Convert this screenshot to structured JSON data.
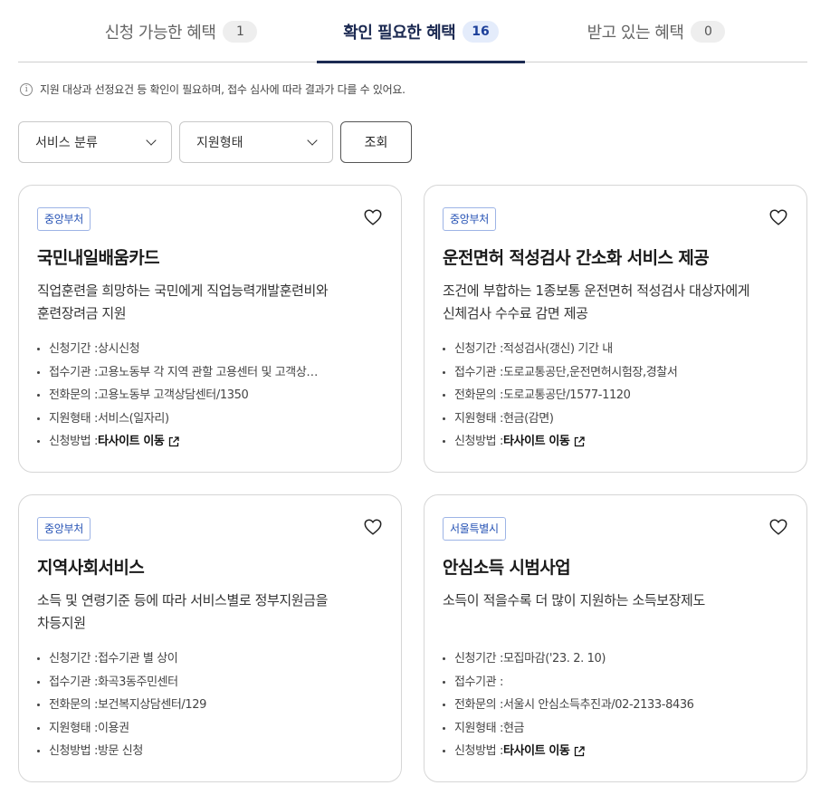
{
  "tabs": [
    {
      "label": "신청 가능한 혜택",
      "count": "1"
    },
    {
      "label": "확인 필요한 혜택",
      "count": "16"
    },
    {
      "label": "받고 있는 혜택",
      "count": "0"
    }
  ],
  "notice": "지원 대상과 선정요건 등 확인이 필요하며, 접수 심사에 따라 결과가 다를 수 있어요.",
  "filters": {
    "service_category": "서비스 분류",
    "support_type": "지원형태",
    "query_button": "조회"
  },
  "labels": {
    "period": "신청기간 : ",
    "agency": "접수기관 : ",
    "phone": "전화문의 : ",
    "type": "지원형태 : ",
    "method": "신청방법 : "
  },
  "cards": [
    {
      "badge": "중앙부처",
      "title": "국민내일배움카드",
      "desc1": "직업훈련을 희망하는 국민에게 직업능력개발훈련비와",
      "desc2": "훈련장려금 지원",
      "period": "상시신청",
      "agency": "고용노동부 각 지역 관할 고용센터 및 고객상…",
      "phone": "고용노동부 고객상담센터/1350",
      "type": "서비스(일자리)",
      "method": "타사이트 이동"
    },
    {
      "badge": "중앙부처",
      "title": "운전면허 적성검사 간소화 서비스 제공",
      "desc1": "조건에 부합하는 1종보통 운전면허 적성검사 대상자에게",
      "desc2": "신체검사 수수료 감면 제공",
      "period": "적성검사(갱신) 기간 내",
      "agency": "도로교통공단,운전면허시험장,경찰서",
      "phone": "도로교통공단/1577-1120",
      "type": "현금(감면)",
      "method": "타사이트 이동"
    },
    {
      "badge": "중앙부처",
      "title": "지역사회서비스",
      "desc1": "소득 및 연령기준 등에 따라 서비스별로 정부지원금을",
      "desc2": "차등지원",
      "period": "접수기관 별 상이",
      "agency": "화곡3동주민센터",
      "phone": "보건복지상담센터/129",
      "type": "이용권",
      "method": "방문 신청"
    },
    {
      "badge": "서울특별시",
      "title": "안심소득 시범사업",
      "desc1": "소득이 적을수록 더 많이 지원하는 소득보장제도",
      "desc2": "",
      "period": "모집마감('23. 2. 10)",
      "agency": "",
      "phone": "서울시 안심소득추진과/02-2133-8436",
      "type": "현금",
      "method": "타사이트 이동"
    }
  ],
  "icons": {
    "info": "info-icon",
    "chevron": "chevron-down-icon",
    "heart": "heart-outline-icon",
    "external": "external-link-icon"
  },
  "colors": {
    "active_tab": "#1c2a52",
    "badge_blue": "#2451b4",
    "count_active_bg": "#e4ecfb"
  }
}
